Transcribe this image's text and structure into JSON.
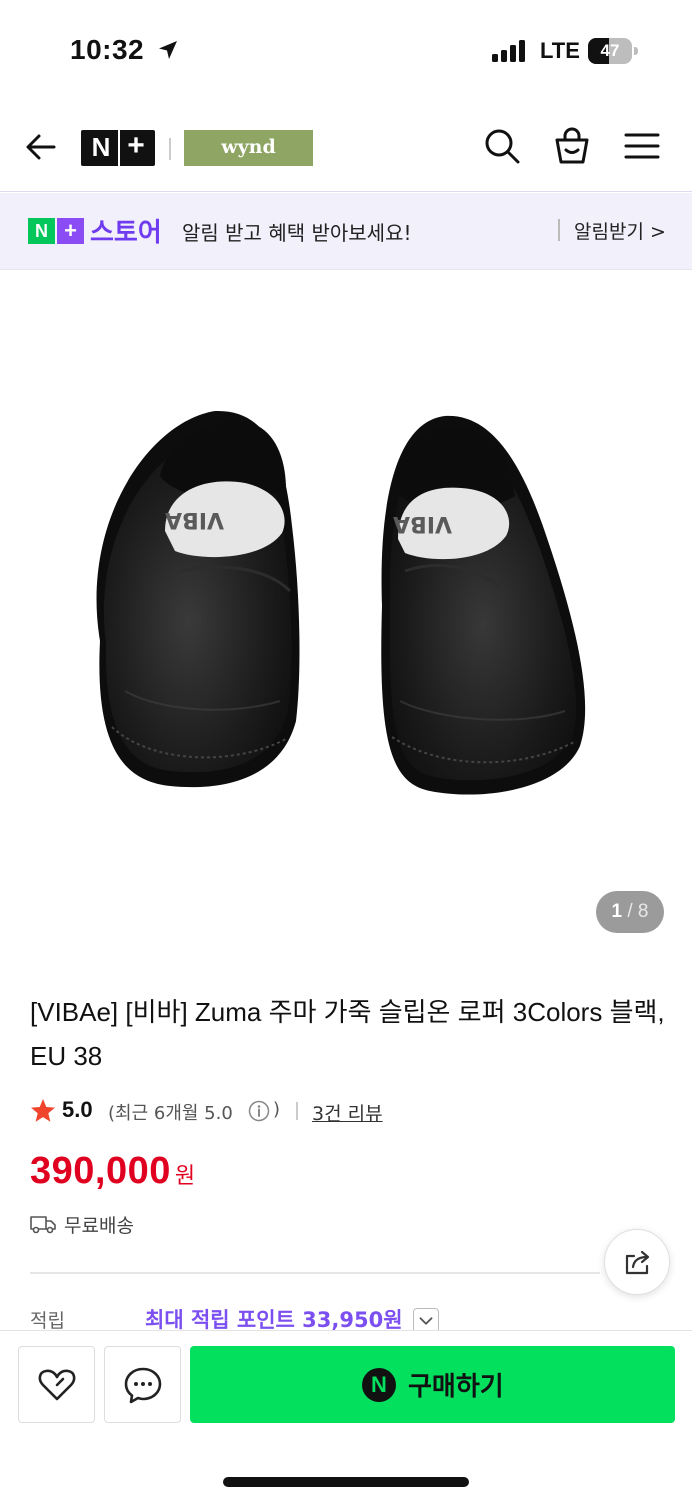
{
  "status_bar": {
    "time": "10:32",
    "network": "LTE",
    "battery_level": "47",
    "battery_fraction": 0.47
  },
  "header": {
    "logo_n": "N",
    "logo_plus": "+",
    "brand": "wynd",
    "icons": [
      "back-arrow-icon",
      "search-icon",
      "shopping-bag-icon",
      "hamburger-menu-icon"
    ]
  },
  "notice": {
    "badge_n": "N",
    "badge_plus": "+",
    "store": "스토어",
    "message": "알림 받고 혜택 받아보세요!",
    "action": "알림받기 >"
  },
  "gallery": {
    "current": "1",
    "separator": "/",
    "total": "8"
  },
  "product": {
    "title": "[VIBAe] [비바] Zuma 주마 가죽 슬립온 로퍼 3Colors 블랙, EU 38",
    "rating": "5.0",
    "recent_rating": "(최근 6개월 5.0",
    "recent_close": ")",
    "review_link": "3건 리뷰",
    "price": "390,000",
    "price_unit": "원",
    "shipping": "무료배송",
    "points_label": "적립",
    "points_value": "최대 적립 포인트 33,950원"
  },
  "bottom_bar": {
    "buy_icon": "N",
    "buy_label": "구매하기"
  },
  "colors": {
    "naver_green": "#03c75a",
    "buy_green": "#03e05e",
    "price_red": "#e0001f",
    "store_purple": "#6f3cf0",
    "brand_olive": "#8fa563"
  }
}
